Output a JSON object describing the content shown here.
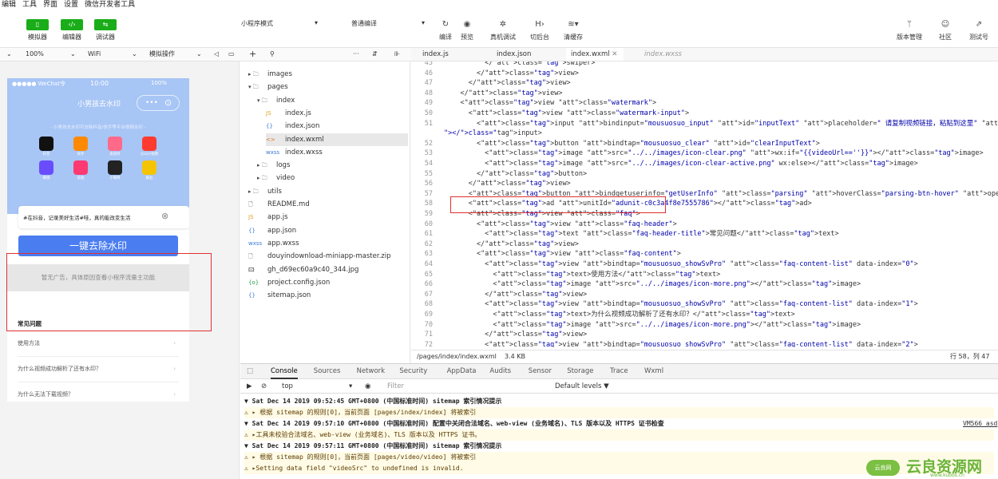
{
  "menu": [
    "编辑",
    "工具",
    "界面",
    "设置",
    "微信开发者工具"
  ],
  "toolbar": {
    "simulator": "模拟器",
    "editor": "编辑器",
    "debugger": "调试器",
    "mode_select": "小程序模式",
    "compile_select": "普通编译",
    "compile": "编译",
    "preview": "预览",
    "real_debug": "真机调试",
    "background": "切后台",
    "clear_cache": "清缓存",
    "version": "版本管理",
    "community": "社区",
    "test": "测试号"
  },
  "subbar": {
    "zoom": "100%",
    "network": "WiFi",
    "sim_op": "模拟操作",
    "search_icon": "search-icon"
  },
  "phone": {
    "status_left": "●●●●● WeChat令",
    "status_time": "10:00",
    "status_right": "100%",
    "title": "小男孩去水印",
    "notice": "- 小男孩去水印可去除抖音/快手等平台视频水印 -",
    "apps": [
      {
        "label": "抖音",
        "color": "#111111"
      },
      {
        "label": "快手",
        "color": "#ff8a00"
      },
      {
        "label": "皮皮虾",
        "color": "#ff6a8a"
      },
      {
        "label": "火山小视频",
        "color": "#ff3b2f"
      },
      {
        "label": "微视",
        "color": "#6a4cff"
      },
      {
        "label": "美拍",
        "color": "#ff3a72"
      },
      {
        "label": "小咖秀",
        "color": "#222222"
      },
      {
        "label": "最右",
        "color": "#f5c400"
      }
    ],
    "input_value": "#在抖音，记录美好生活#哇，真的能改变生活",
    "main_button": "一键去除水印",
    "ad_text": "暂无广告，具体原因查看小程序流量主功能",
    "faq_title": "常见问题",
    "faq_items": [
      "使用方法",
      "为什么视频成功解析了还有水印？",
      "为什么无法下载视频？"
    ]
  },
  "tree": {
    "toolbar_add": "+",
    "items": [
      {
        "name": "images",
        "type": "folder",
        "indent": 0,
        "open": false
      },
      {
        "name": "pages",
        "type": "folder",
        "indent": 0,
        "open": true
      },
      {
        "name": "index",
        "type": "folder",
        "indent": 1,
        "open": true
      },
      {
        "name": "index.js",
        "type": "js",
        "indent": 2
      },
      {
        "name": "index.json",
        "type": "json",
        "indent": 2
      },
      {
        "name": "index.wxml",
        "type": "wxml",
        "indent": 2,
        "selected": true
      },
      {
        "name": "index.wxss",
        "type": "wxss",
        "indent": 2
      },
      {
        "name": "logs",
        "type": "folder",
        "indent": 1,
        "open": false
      },
      {
        "name": "video",
        "type": "folder",
        "indent": 1,
        "open": false
      },
      {
        "name": "utils",
        "type": "folder",
        "indent": 0,
        "open": false
      },
      {
        "name": "README.md",
        "type": "file",
        "indent": 0
      },
      {
        "name": "app.js",
        "type": "js",
        "indent": 0
      },
      {
        "name": "app.json",
        "type": "json",
        "indent": 0
      },
      {
        "name": "app.wxss",
        "type": "wxss",
        "indent": 0
      },
      {
        "name": "douyindownload-miniapp-master.zip",
        "type": "file",
        "indent": 0
      },
      {
        "name": "gh_d69ec60a9c40_344.jpg",
        "type": "img",
        "indent": 0
      },
      {
        "name": "project.config.json",
        "type": "cfg",
        "indent": 0
      },
      {
        "name": "sitemap.json",
        "type": "json",
        "indent": 0
      }
    ]
  },
  "editor": {
    "tabs": [
      "index.js",
      "index.json",
      "index.wxml",
      "index.wxss"
    ],
    "active_tab": 2,
    "lines": [
      {
        "n": "45",
        "t": "          </swiper>"
      },
      {
        "n": "46",
        "t": "        </view>"
      },
      {
        "n": "47",
        "t": "      </view>"
      },
      {
        "n": "48",
        "t": "    </view>"
      },
      {
        "n": "49",
        "t": "    <view class=\"watermark\">"
      },
      {
        "n": "50",
        "t": "      <view class=\"watermark-input\">"
      },
      {
        "n": "51",
        "t": "        <input bindinput=\"mousuosuo_input\" id=\"inputText\" placeholder=\" 请复制视频链接，粘贴到这里\" type=\"text\" value=\"{{defaultUr"
      },
      {
        "n": "",
        "t": "\"></input>"
      },
      {
        "n": "52",
        "t": "        <button bindtap=\"mousuosuo_clear\" id=\"clearInputText\">"
      },
      {
        "n": "53",
        "t": "          <image src=\"../../images/icon-clear.png\" wx:if=\"{{videoUrl==''}}\"></image>"
      },
      {
        "n": "54",
        "t": "          <image src=\"../../images/icon-clear-active.png\" wx:else></image>"
      },
      {
        "n": "55",
        "t": "        </button>"
      },
      {
        "n": "56",
        "t": "      </view>"
      },
      {
        "n": "57",
        "t": "      <button bindgetuserinfo=\"getUserInfo\" class=\"parsing\" hoverClass=\"parsing-btn-hover\" openType=\"getUserInfo\">一键去除水印</b"
      },
      {
        "n": "58",
        "t": "      <ad unitId=\"adunit-c0c3a4f8e7555786\"></ad>"
      },
      {
        "n": "59",
        "t": "      <view class=\"faq\">"
      },
      {
        "n": "60",
        "t": "        <view class=\"faq-header\">"
      },
      {
        "n": "61",
        "t": "          <text class=\"faq-header-title\">常见问题</text>"
      },
      {
        "n": "62",
        "t": "        </view>"
      },
      {
        "n": "63",
        "t": "        <view class=\"faq-content\">"
      },
      {
        "n": "64",
        "t": "          <view bindtap=\"mousuosuo_showSvPro\" class=\"faq-content-list\" data-index=\"0\">"
      },
      {
        "n": "65",
        "t": "            <text>使用方法</text>"
      },
      {
        "n": "66",
        "t": "            <image src=\"../../images/icon-more.png\"></image>"
      },
      {
        "n": "67",
        "t": "          </view>"
      },
      {
        "n": "68",
        "t": "          <view bindtap=\"mousuosuo_showSvPro\" class=\"faq-content-list\" data-index=\"1\">"
      },
      {
        "n": "69",
        "t": "            <text>为什么视频成功解析了还有水印？</text>"
      },
      {
        "n": "70",
        "t": "            <image src=\"../../images/icon-more.png\"></image>"
      },
      {
        "n": "71",
        "t": "          </view>"
      },
      {
        "n": "72",
        "t": "          <view bindtap=\"mousuosuo_showSvPro\" class=\"faq-content-list\" data-index=\"2\">"
      }
    ],
    "status_path": "/pages/index/index.wxml",
    "status_size": "3.4 KB",
    "status_pos": "行 58，列 47"
  },
  "console": {
    "tabs": [
      "Console",
      "Sources",
      "Network",
      "Security",
      "AppData",
      "Audits",
      "Sensor",
      "Storage",
      "Trace",
      "Wxml"
    ],
    "context": "top",
    "filter_placeholder": "Filter",
    "levels": "Default levels ▼",
    "logs": [
      {
        "kind": "group",
        "text": "▼ Sat Dec 14 2019 09:52:45 GMT+0800 (中国标准时间) sitemap 索引情况提示"
      },
      {
        "kind": "warn",
        "text": "  ⚠ ▸ 根据 sitemap 的规则[0]，当前页面 [pages/index/index] 将被索引"
      },
      {
        "kind": "group",
        "text": "▼ Sat Dec 14 2019 09:57:10 GMT+0800 (中国标准时间) 配置中关闭合法域名、web-view (业务域名)、TLS 版本以及 HTTPS 证书检查"
      },
      {
        "kind": "warn",
        "text": "  ⚠ ▸工具未校验合法域名、web-view (业务域名)、TLS 版本以及 HTTPS 证书。"
      },
      {
        "kind": "group",
        "text": "▼ Sat Dec 14 2019 09:57:11 GMT+0800 (中国标准时间) sitemap 索引情况提示"
      },
      {
        "kind": "warn",
        "text": "  ⚠ ▸ 根据 sitemap 的规则[0]，当前页面 [pages/video/video] 将被索引"
      },
      {
        "kind": "warn",
        "text": "⚠ ▸Setting data field \"videoSrc\" to undefined is invalid."
      }
    ],
    "vm_link": "VM566 asd"
  },
  "watermark": {
    "left": "云良网",
    "main": "云良资源网",
    "url": "www.kubbs.cn"
  }
}
